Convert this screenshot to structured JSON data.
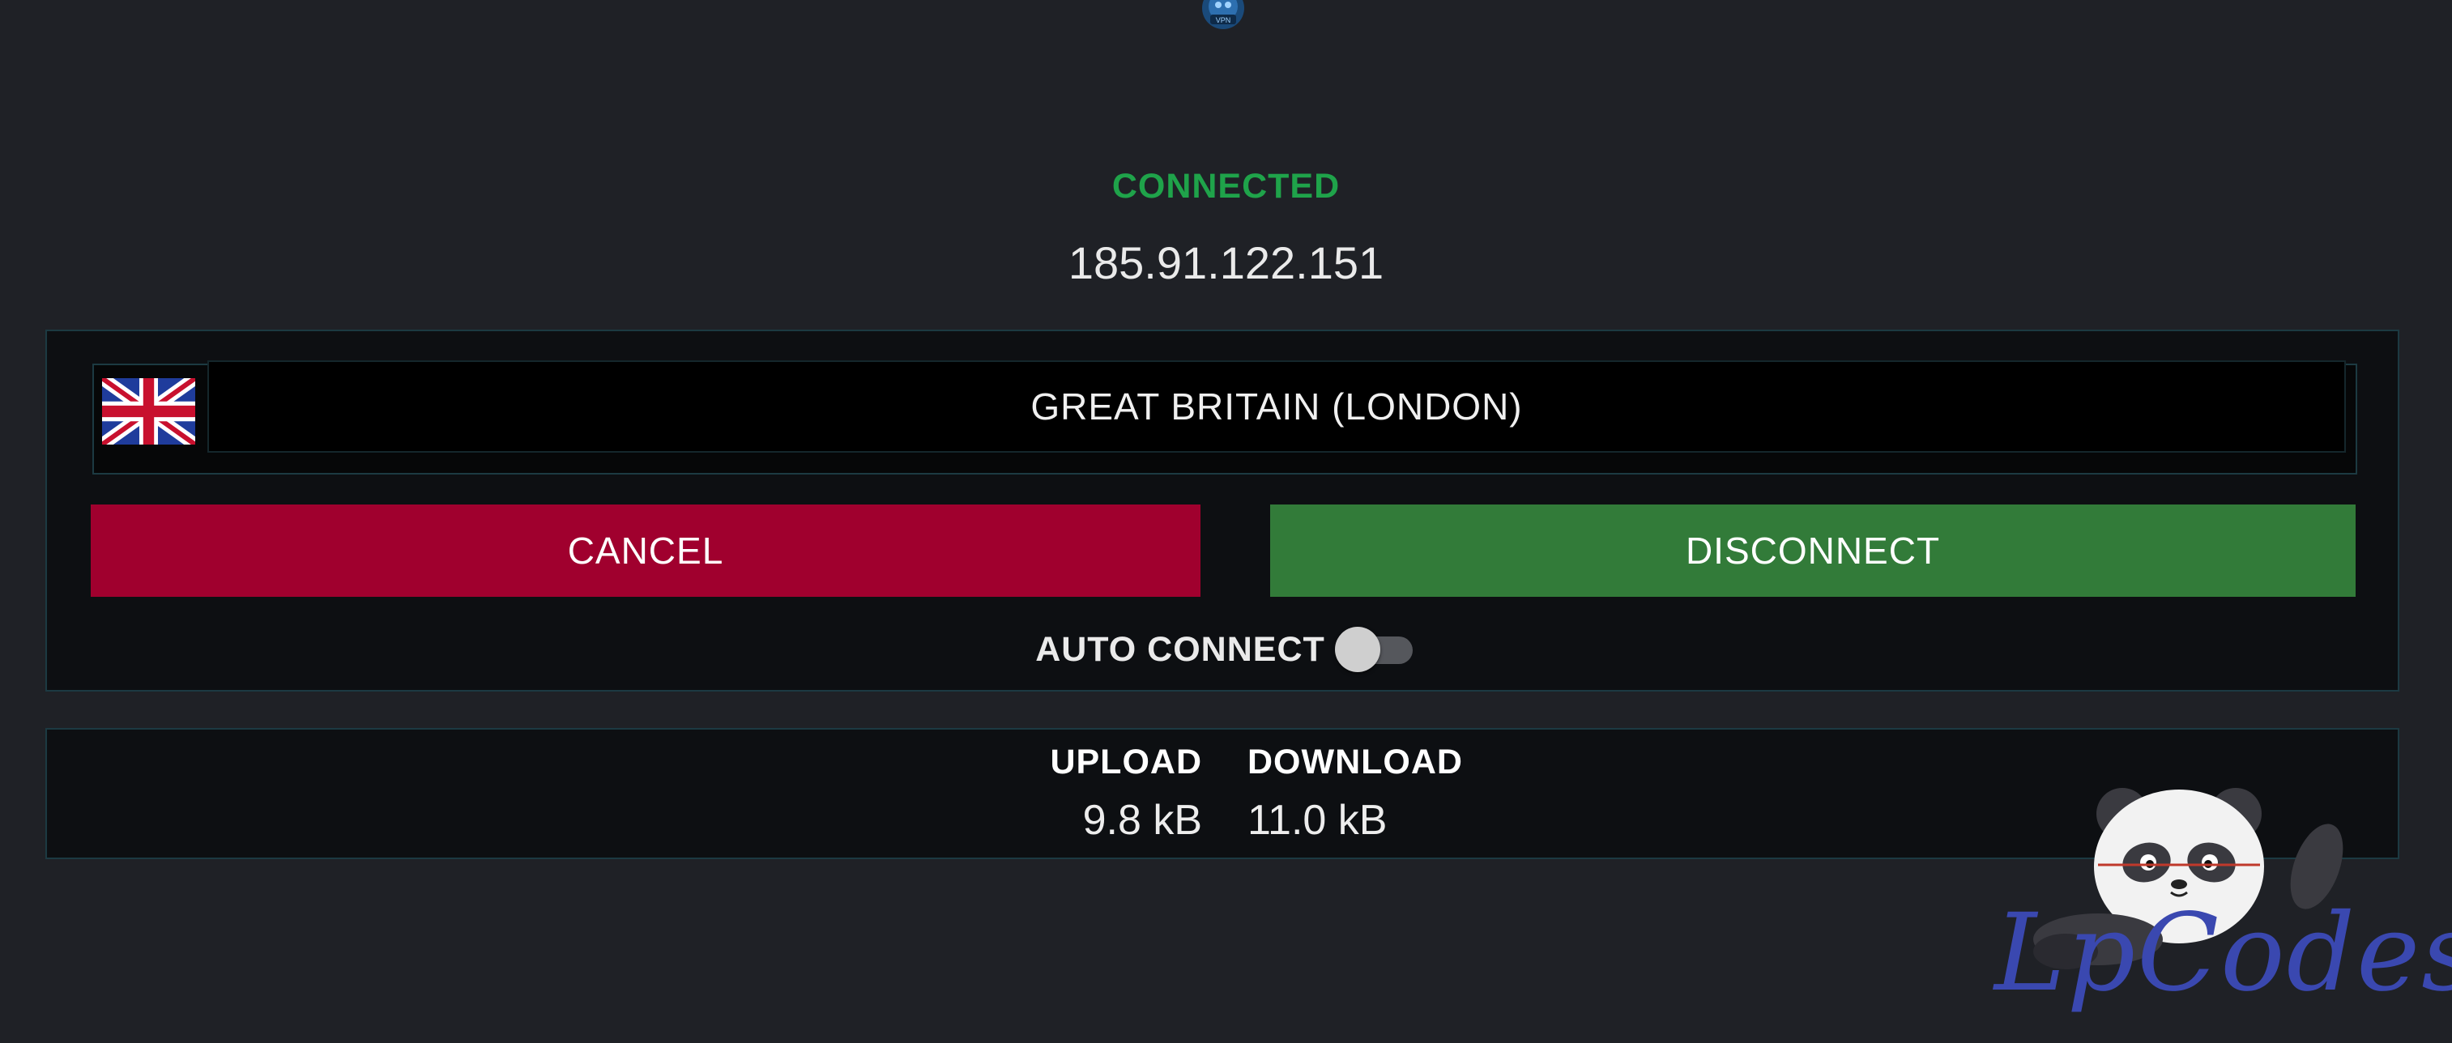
{
  "status": {
    "label": "CONNECTED",
    "color": "#1fa34a"
  },
  "connection": {
    "ip": "185.91.122.151"
  },
  "server": {
    "flag_icon": "uk-flag-icon",
    "name": "GREAT BRITAIN (LONDON)"
  },
  "actions": {
    "cancel_label": "CANCEL",
    "disconnect_label": "DISCONNECT"
  },
  "auto_connect": {
    "label": "AUTO CONNECT",
    "enabled": false
  },
  "stats": {
    "upload_label": "UPLOAD",
    "upload_value": "9.8 kB",
    "download_label": "DOWNLOAD",
    "download_value": "11.0 kB"
  },
  "watermark": {
    "text": "LpCodes",
    "icon": "panda-mascot-icon"
  },
  "colors": {
    "background": "#1f2126",
    "panel": "#0d0f12",
    "cancel": "#a0002e",
    "disconnect": "#327b39",
    "watermark": "#3a48b0"
  }
}
